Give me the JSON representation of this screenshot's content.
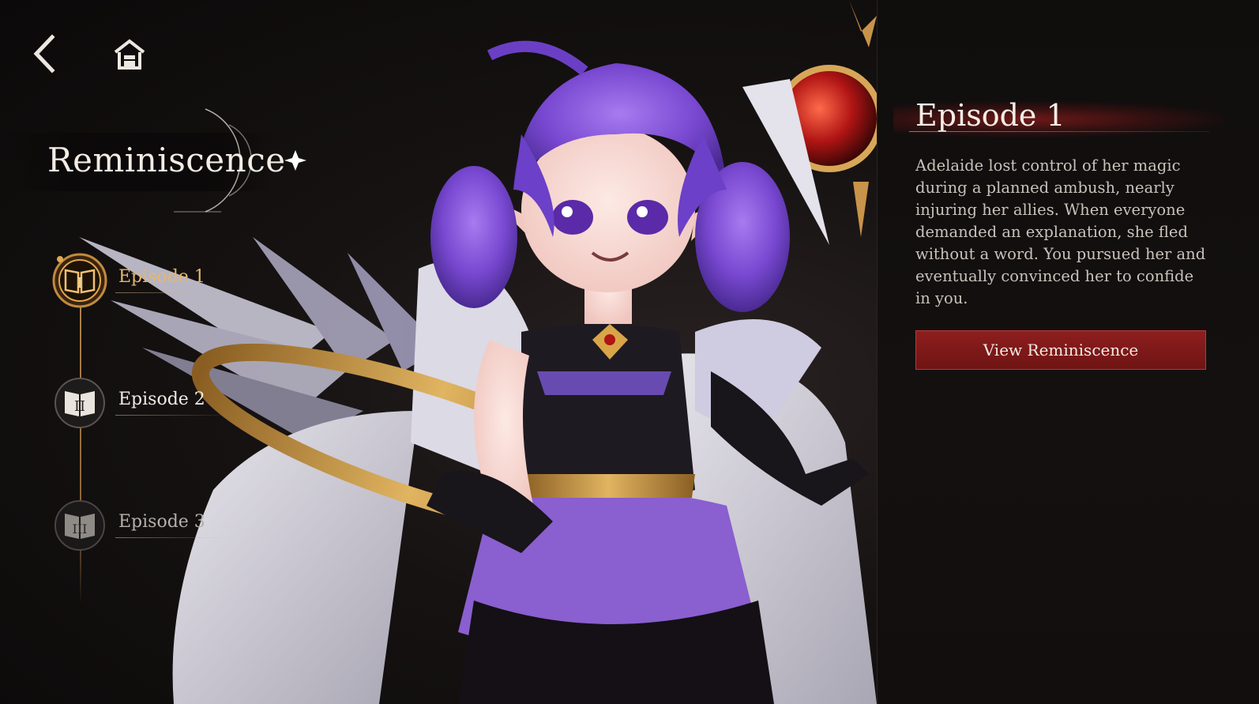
{
  "nav": {
    "back_icon": "back-arrow-icon",
    "home_icon": "home-icon"
  },
  "title": "Reminiscence",
  "episodes": [
    {
      "numeral": "I",
      "label": "Episode 1",
      "state": "selected"
    },
    {
      "numeral": "II",
      "label": "Episode 2",
      "state": "available"
    },
    {
      "numeral": "III",
      "label": "Episode 3",
      "state": "locked"
    }
  ],
  "detail": {
    "title": "Episode 1",
    "description": "Adelaide lost control of her magic during a planned ambush, nearly injuring her allies. When everyone demanded an explanation, she fled without a word. You pursued her and eventually convinced her to confide in you.",
    "button_label": "View Reminiscence"
  },
  "colors": {
    "accent_gold": "#e7b66b",
    "accent_red": "#8e1e1e",
    "character_hair": "#7b4fd6"
  }
}
